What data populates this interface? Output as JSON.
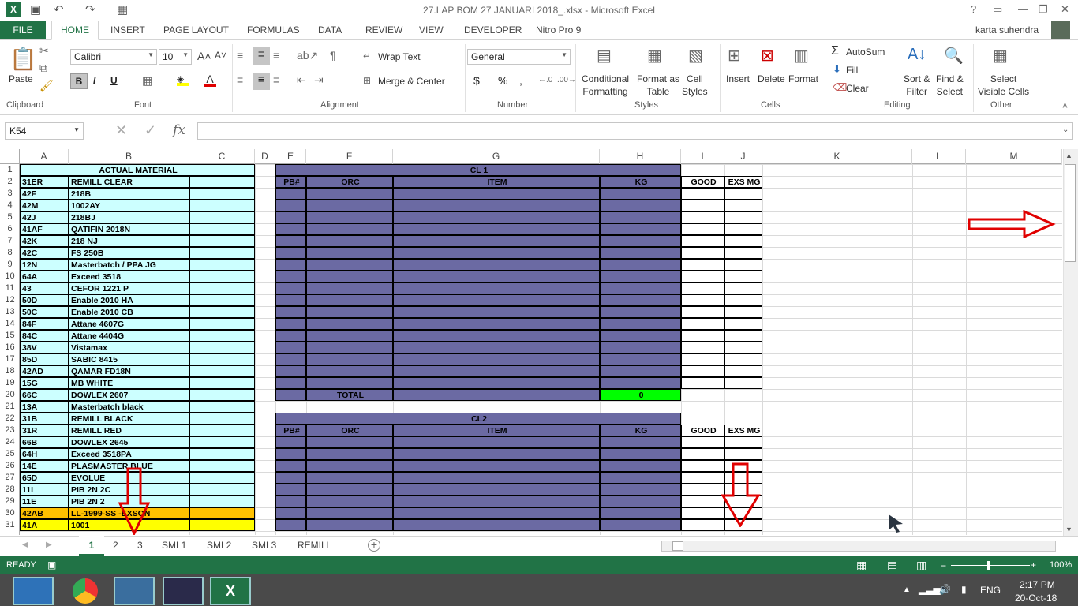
{
  "window": {
    "title": "27.LAP BOM 27 JANUARI 2018_.xlsx - Microsoft Excel",
    "user": "karta suhendra"
  },
  "ribbon_tabs": [
    "FILE",
    "HOME",
    "INSERT",
    "PAGE LAYOUT",
    "FORMULAS",
    "DATA",
    "REVIEW",
    "VIEW",
    "DEVELOPER",
    "Nitro Pro 9"
  ],
  "ribbon": {
    "clipboard": {
      "label": "Clipboard",
      "paste": "Paste"
    },
    "font": {
      "label": "Font",
      "name": "Calibri",
      "size": "10",
      "bold": "B",
      "italic": "I",
      "underline": "U"
    },
    "alignment": {
      "label": "Alignment",
      "wrap": "Wrap Text",
      "merge": "Merge & Center"
    },
    "number": {
      "label": "Number",
      "format": "General",
      "currency": "$",
      "percent": "%",
      "comma": ","
    },
    "styles": {
      "label": "Styles",
      "conditional": "Conditional",
      "conditional2": "Formatting",
      "format_as": "Format as",
      "format_as2": "Table",
      "cell": "Cell",
      "cell2": "Styles"
    },
    "cells": {
      "label": "Cells",
      "insert": "Insert",
      "delete": "Delete",
      "format": "Format"
    },
    "editing": {
      "label": "Editing",
      "autosum": "AutoSum",
      "fill": "Fill",
      "clear": "Clear",
      "sort": "Sort &",
      "sort2": "Filter",
      "find": "Find &",
      "find2": "Select"
    },
    "other": {
      "label": "Other",
      "select": "Select",
      "select2": "Visible Cells"
    }
  },
  "formula_bar": {
    "name_box": "K54",
    "fx": "fx",
    "value": ""
  },
  "columns": [
    "A",
    "B",
    "C",
    "D",
    "E",
    "F",
    "G",
    "H",
    "I",
    "J",
    "K",
    "L",
    "M"
  ],
  "rows": [
    "1",
    "2",
    "3",
    "4",
    "5",
    "6",
    "7",
    "8",
    "9",
    "10",
    "11",
    "12",
    "13",
    "14",
    "15",
    "16",
    "17",
    "18",
    "19",
    "20",
    "21",
    "22",
    "23",
    "24",
    "25",
    "26",
    "27",
    "28",
    "29",
    "30",
    "31"
  ],
  "material_header": "ACTUAL MATERIAL",
  "materials": [
    [
      "31ER",
      "REMILL CLEAR"
    ],
    [
      "42F",
      "218B"
    ],
    [
      "42M",
      "1002AY"
    ],
    [
      "42J",
      "218BJ"
    ],
    [
      "41AF",
      "QATIFIN 2018N"
    ],
    [
      "42K",
      "218 NJ"
    ],
    [
      "42C",
      "FS 250B"
    ],
    [
      "12N",
      "Masterbatch / PPA JG"
    ],
    [
      "64A",
      "Exceed 3518"
    ],
    [
      "43",
      "CEFOR 1221 P"
    ],
    [
      "50D",
      "Enable 2010 HA"
    ],
    [
      "50C",
      "Enable 2010 CB"
    ],
    [
      "84F",
      "Attane 4607G"
    ],
    [
      "84C",
      "Attane 4404G"
    ],
    [
      "38V",
      "Vistamax"
    ],
    [
      "85D",
      "SABIC 8415"
    ],
    [
      "42AD",
      "QAMAR FD18N"
    ],
    [
      "15G",
      "MB WHITE"
    ],
    [
      "66C",
      "DOWLEX 2607"
    ],
    [
      "13A",
      "Masterbatch black"
    ],
    [
      "31B",
      "REMILL BLACK"
    ],
    [
      "31R",
      "REMILL RED"
    ],
    [
      "66B",
      "DOWLEX 2645"
    ],
    [
      "64H",
      "Exceed 3518PA"
    ],
    [
      "14E",
      "PLASMASTER BLUE"
    ],
    [
      "65D",
      "EVOLUE"
    ],
    [
      "11I",
      "PIB 2N 2C"
    ],
    [
      "11E",
      "PIB 2N 2"
    ],
    [
      "42AB",
      "LL-1999-SS -EXSON"
    ],
    [
      "41A",
      "1001"
    ]
  ],
  "cl1": {
    "title": "CL 1",
    "headers": [
      "PB#",
      "ORC",
      "ITEM",
      "KG",
      "GOOD",
      "EXS MG"
    ],
    "total_label": "TOTAL",
    "total_value": "0"
  },
  "cl2": {
    "title": "CL2",
    "headers": [
      "PB#",
      "ORC",
      "ITEM",
      "KG",
      "GOOD",
      "EXS MG"
    ]
  },
  "sheets": [
    "1",
    "2",
    "3",
    "SML1",
    "SML2",
    "SML3",
    "REMILL"
  ],
  "status": {
    "ready": "READY",
    "zoom": "100%"
  },
  "taskbar": {
    "lang": "ENG",
    "time": "2:17 PM",
    "date": "20-Oct-18"
  },
  "colors": {
    "excel_green": "#217346",
    "cyan": "#ccffff",
    "purple": "#6b6aa3",
    "orange": "#ffc000",
    "yellow": "#ffff00",
    "green": "#00ff00",
    "arrow_red": "#e00000"
  }
}
